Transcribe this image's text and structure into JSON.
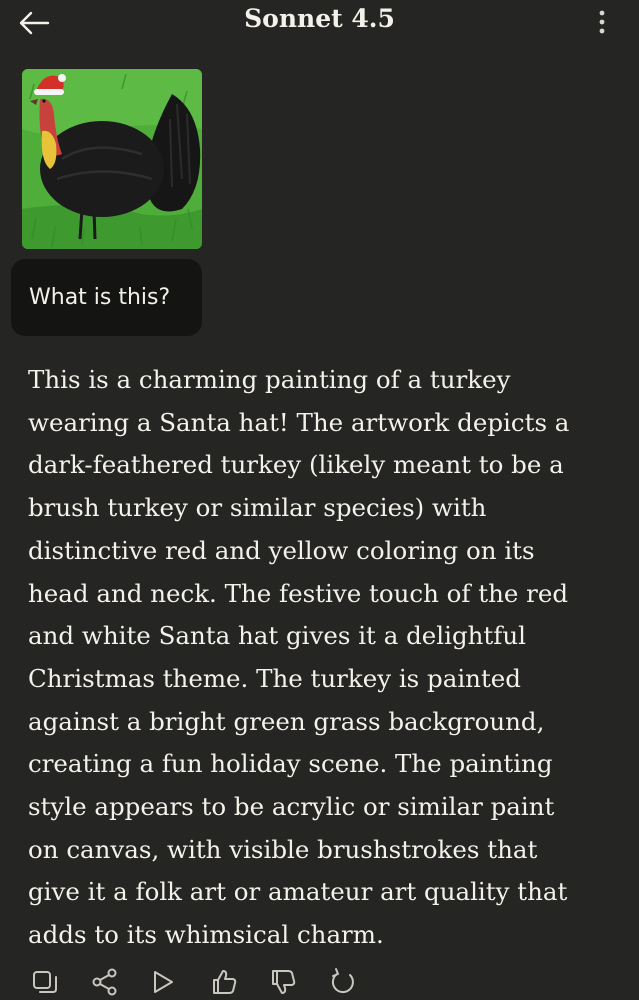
{
  "header": {
    "title": "Sonnet 4.5",
    "back_icon": "arrow-left-icon",
    "menu_icon": "more-vertical-icon"
  },
  "attachment": {
    "kind": "painting of a black turkey wearing a santa hat on green grass"
  },
  "user_message": {
    "text": "What is this?"
  },
  "response": {
    "lines": [
      "This is a charming painting of a turkey",
      "wearing a Santa hat! The artwork depicts a",
      "dark-feathered turkey (likely meant to be a",
      "brush turkey or similar species) with",
      "distinctive red and yellow coloring on its",
      "head and neck. The festive touch of the red",
      "and white Santa hat gives it a delightful",
      "Christmas theme. The turkey is painted",
      "against a bright green grass background,",
      "creating a fun holiday scene. The painting",
      "style appears to be acrylic or similar paint",
      "on canvas, with visible brushstrokes that",
      "give it a folk art or amateur art quality that",
      "adds to its whimsical charm."
    ]
  },
  "actions": [
    "copy-icon",
    "share-icon",
    "play-icon",
    "thumbs-up-icon",
    "thumbs-down-icon",
    "retry-icon"
  ],
  "colors": {
    "background": "#252523",
    "bubble": "#141412",
    "text": "#f4f1ea",
    "icon": "#c9c6be"
  }
}
